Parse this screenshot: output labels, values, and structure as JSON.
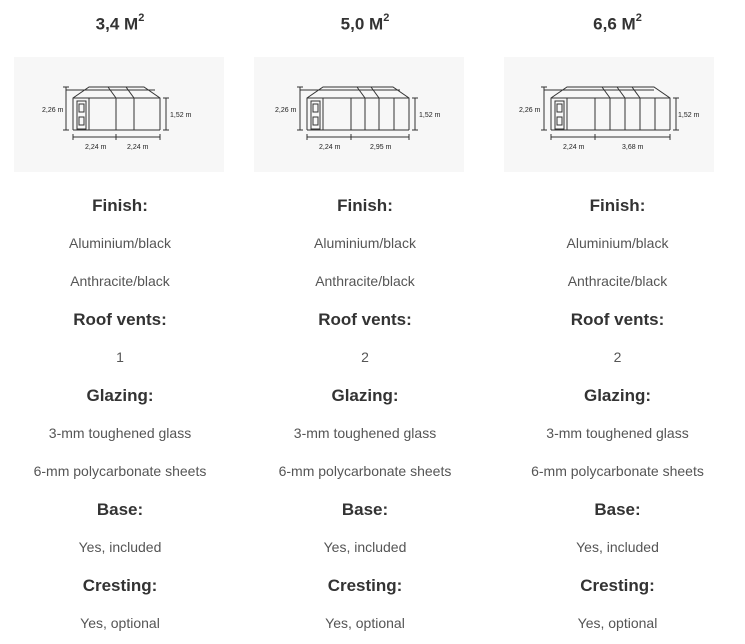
{
  "columns": [
    {
      "title": "3,4 M",
      "title_sup": "2",
      "dims": {
        "height": "2,26 m",
        "side": "1,52 m",
        "width": "2,24 m",
        "length": "2,24 m"
      },
      "finish_label": "Finish:",
      "finish": [
        "Aluminium/black",
        "Anthracite/black"
      ],
      "roof_vents_label": "Roof vents:",
      "roof_vents": "1",
      "glazing_label": "Glazing:",
      "glazing": [
        "3-mm toughened glass",
        "6-mm polycarbonate sheets"
      ],
      "base_label": "Base:",
      "base": "Yes, included",
      "cresting_label": "Cresting:",
      "cresting": "Yes, optional"
    },
    {
      "title": "5,0 M",
      "title_sup": "2",
      "dims": {
        "height": "2,26 m",
        "side": "1,52 m",
        "width": "2,24 m",
        "length": "2,95 m"
      },
      "finish_label": "Finish:",
      "finish": [
        "Aluminium/black",
        "Anthracite/black"
      ],
      "roof_vents_label": "Roof vents:",
      "roof_vents": "2",
      "glazing_label": "Glazing:",
      "glazing": [
        "3-mm toughened glass",
        "6-mm polycarbonate sheets"
      ],
      "base_label": "Base:",
      "base": "Yes, included",
      "cresting_label": "Cresting:",
      "cresting": "Yes, optional"
    },
    {
      "title": "6,6 M",
      "title_sup": "2",
      "dims": {
        "height": "2,26 m",
        "side": "1,52 m",
        "width": "2,24 m",
        "length": "3,68 m"
      },
      "finish_label": "Finish:",
      "finish": [
        "Aluminium/black",
        "Anthracite/black"
      ],
      "roof_vents_label": "Roof vents:",
      "roof_vents": "2",
      "glazing_label": "Glazing:",
      "glazing": [
        "3-mm toughened glass",
        "6-mm polycarbonate sheets"
      ],
      "base_label": "Base:",
      "base": "Yes, included",
      "cresting_label": "Cresting:",
      "cresting": "Yes, optional"
    }
  ]
}
